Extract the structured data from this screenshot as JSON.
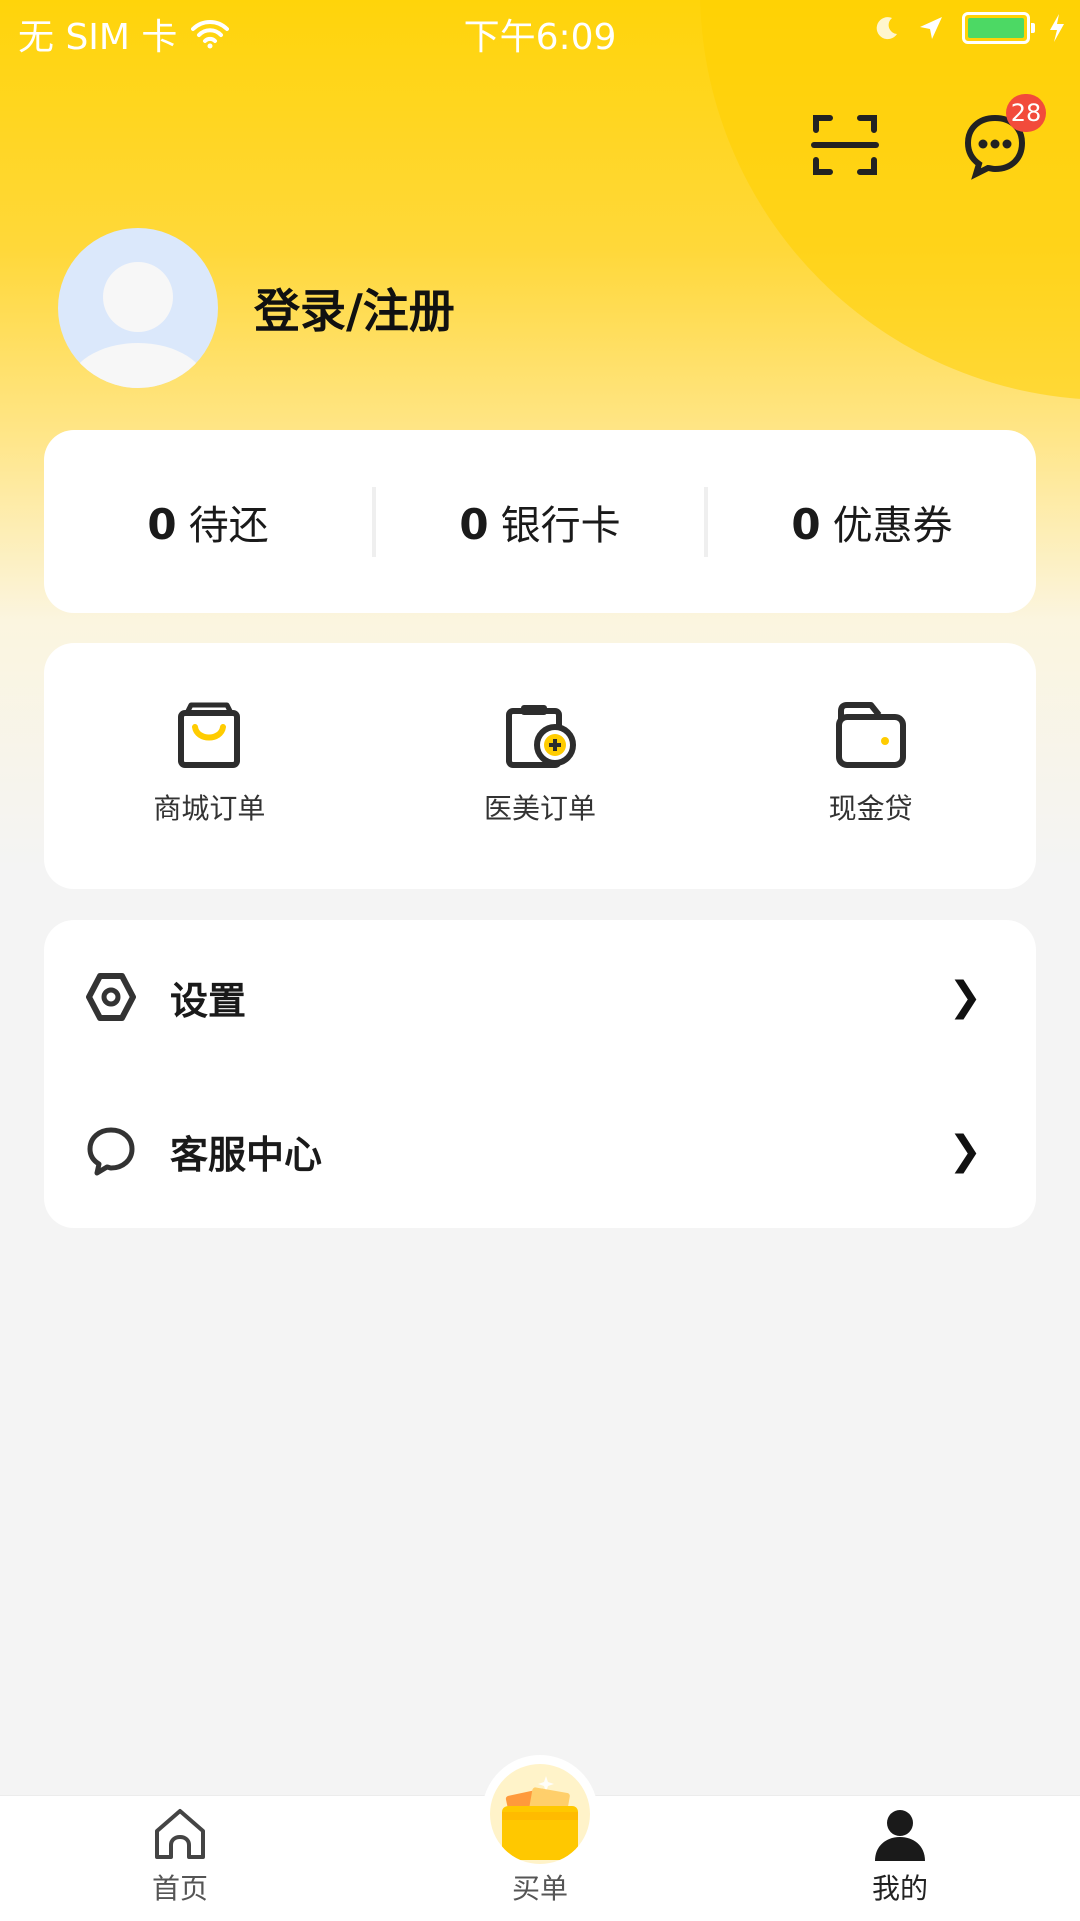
{
  "status_bar": {
    "carrier": "无 SIM 卡",
    "time": "下午6:09",
    "battery_color": "#4cd964"
  },
  "header": {
    "scan_icon": "scan-icon",
    "message_icon": "message-icon",
    "message_badge": "28"
  },
  "profile": {
    "login_label": "登录/注册",
    "avatar_icon": "default-avatar-icon"
  },
  "stats": [
    {
      "count": "0",
      "label": "待还"
    },
    {
      "count": "0",
      "label": "银行卡"
    },
    {
      "count": "0",
      "label": "优惠券"
    }
  ],
  "quick_actions": [
    {
      "label": "商城订单",
      "icon": "shopping-bag-icon"
    },
    {
      "label": "医美订单",
      "icon": "medical-clipboard-icon"
    },
    {
      "label": "现金贷",
      "icon": "wallet-icon"
    }
  ],
  "menu": [
    {
      "label": "设置",
      "icon": "settings-hex-icon"
    },
    {
      "label": "客服中心",
      "icon": "chat-bubble-icon"
    }
  ],
  "tabbar": [
    {
      "label": "首页",
      "icon": "home-icon"
    },
    {
      "label": "买单",
      "icon": "wallet-coin-icon"
    },
    {
      "label": "我的",
      "icon": "person-icon"
    }
  ],
  "colors": {
    "accent_yellow": "#ffd40a",
    "badge_red": "#f24b3b",
    "icon_dark": "#2d2d2d"
  }
}
